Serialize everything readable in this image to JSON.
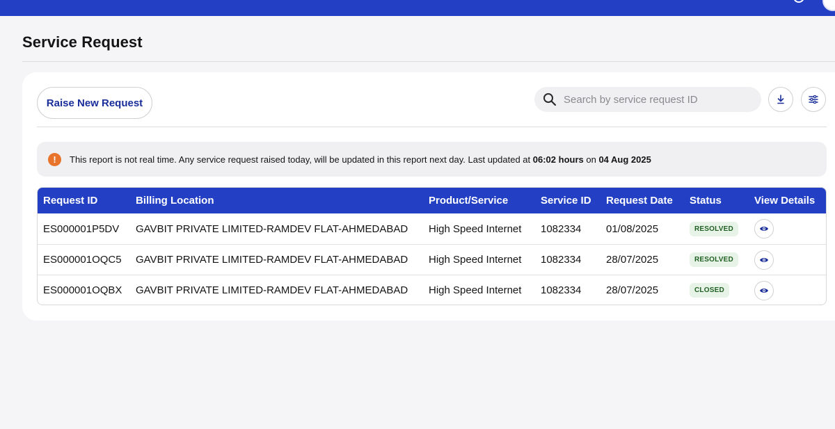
{
  "page": {
    "title": "Service Request"
  },
  "actions": {
    "raise_label": "Raise New Request",
    "search_placeholder": "Search by service request ID",
    "search_value": ""
  },
  "notice": {
    "text_before": "This report is not real time. Any service request raised today, will be updated in this report next day. Last updated at ",
    "time": "06:02 hours",
    "text_mid": " on ",
    "date": "04 Aug 2025"
  },
  "table": {
    "headers": [
      "Request ID",
      "Billing Location",
      "Product/Service",
      "Service ID",
      "Request Date",
      "Status",
      "View Details"
    ],
    "rows": [
      {
        "request_id": "ES000001P5DV",
        "billing_location": "GAVBIT PRIVATE LIMITED-RAMDEV FLAT-AHMEDABAD",
        "product": "High Speed Internet",
        "service_id": "1082334",
        "request_date": "01/08/2025",
        "status": "RESOLVED"
      },
      {
        "request_id": "ES000001OQC5",
        "billing_location": "GAVBIT PRIVATE LIMITED-RAMDEV FLAT-AHMEDABAD",
        "product": "High Speed Internet",
        "service_id": "1082334",
        "request_date": "28/07/2025",
        "status": "RESOLVED"
      },
      {
        "request_id": "ES000001OQBX",
        "billing_location": "GAVBIT PRIVATE LIMITED-RAMDEV FLAT-AHMEDABAD",
        "product": "High Speed Internet",
        "service_id": "1082334",
        "request_date": "28/07/2025",
        "status": "CLOSED"
      }
    ]
  },
  "icons": {
    "search": "search-icon",
    "download": "download-icon",
    "filter": "filter-icon",
    "warning": "warning-icon",
    "view": "eye-icon"
  },
  "colors": {
    "brand": "#2340c4",
    "accent_text": "#1a2e9a",
    "warning": "#e8732a",
    "status_bg": "#e8f3e8",
    "status_text": "#1f5f22"
  }
}
